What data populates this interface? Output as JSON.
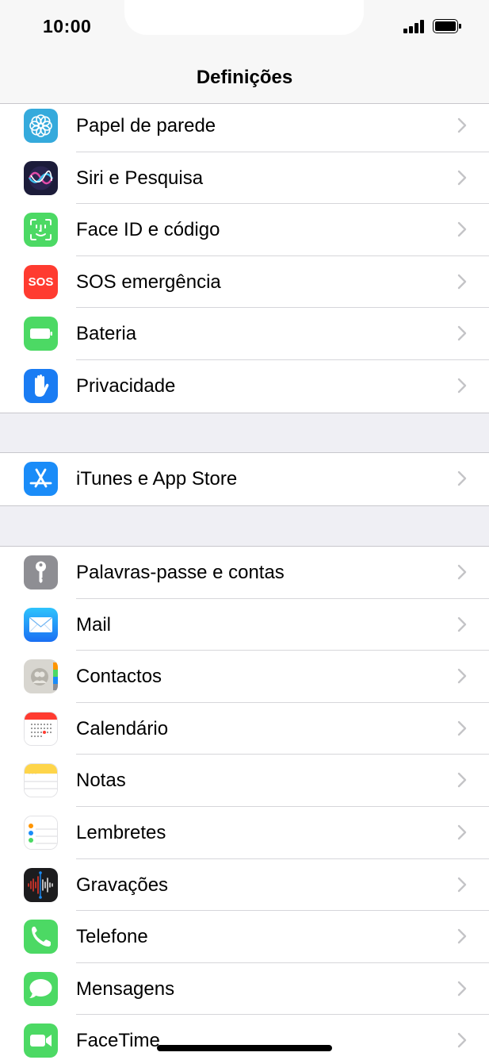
{
  "status": {
    "time": "10:00"
  },
  "nav": {
    "title": "Definições"
  },
  "group1": [
    {
      "label": "Papel de parede",
      "icon": "wallpaper-icon",
      "color": "#35aadc"
    },
    {
      "label": "Siri e Pesquisa",
      "icon": "siri-icon",
      "color": "#1c1c3a"
    },
    {
      "label": "Face ID e código",
      "icon": "face-id-icon",
      "color": "#4cd964"
    },
    {
      "label": "SOS emergência",
      "icon": "sos-icon",
      "color": "#ff3b30",
      "icon_text": "SOS"
    },
    {
      "label": "Bateria",
      "icon": "battery-icon",
      "color": "#4cd964"
    },
    {
      "label": "Privacidade",
      "icon": "privacy-hand-icon",
      "color": "#1a7cf3"
    }
  ],
  "group2": [
    {
      "label": "iTunes e App Store",
      "icon": "app-store-icon",
      "color": "#1a8cf8"
    }
  ],
  "group3": [
    {
      "label": "Palavras-passe e contas",
      "icon": "key-icon",
      "color": "#8e8e93"
    },
    {
      "label": "Mail",
      "icon": "mail-icon",
      "color": "#1f8cf7"
    },
    {
      "label": "Contactos",
      "icon": "contacts-icon",
      "color": "#d8d6d0"
    },
    {
      "label": "Calendário",
      "icon": "calendar-icon",
      "color": "#ffffff"
    },
    {
      "label": "Notas",
      "icon": "notes-icon",
      "color": "#ffffff"
    },
    {
      "label": "Lembretes",
      "icon": "reminders-icon",
      "color": "#ffffff"
    },
    {
      "label": "Gravações",
      "icon": "voice-memos-icon",
      "color": "#1c1c1e"
    },
    {
      "label": "Telefone",
      "icon": "phone-icon",
      "color": "#4cd964"
    },
    {
      "label": "Mensagens",
      "icon": "messages-icon",
      "color": "#4cd964"
    },
    {
      "label": "FaceTime",
      "icon": "facetime-icon",
      "color": "#4cd964"
    }
  ]
}
